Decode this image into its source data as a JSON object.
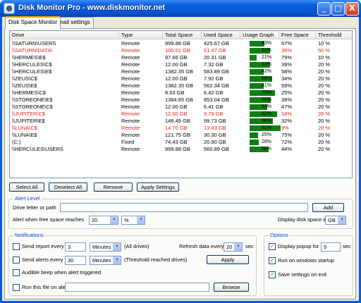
{
  "window": {
    "title": "Disk Monitor Pro - www.diskmonitor.net",
    "minimize_glyph": "_",
    "maximize_glyph": "□",
    "close_glyph": "X"
  },
  "tabs": [
    {
      "label": "Disk Space Monitor",
      "active": true
    },
    {
      "label": "Email settings",
      "active": false
    }
  ],
  "table": {
    "columns": [
      "Drive",
      "Type",
      "Total Space",
      "Used Space",
      "Usage Graph",
      "Free Space",
      "Threshold"
    ],
    "rows": [
      {
        "drive": "\\\\SATURN\\USERS",
        "type": "Remote",
        "total": "999.88 GB",
        "used": "425.67 GB",
        "usage": 43,
        "usage_label": "43%",
        "free": "57%",
        "threshold": "10 %",
        "alert": false
      },
      {
        "drive": "\\\\SATURN\\DATA\\",
        "type": "Remote",
        "total": "100.01 GB",
        "used": "61.47 GB",
        "usage": 61,
        "usage_label": "61%",
        "free": "39%",
        "threshold": "50 %",
        "alert": true
      },
      {
        "drive": "\\\\HERMES\\E$",
        "type": "Remote",
        "total": "97.66 GB",
        "used": "20.31 GB",
        "usage": 21,
        "usage_label": "21%",
        "free": "79%",
        "threshold": "10 %",
        "alert": false
      },
      {
        "drive": "\\\\HERCULES\\C$",
        "type": "Remote",
        "total": "12.00 GB",
        "used": "7.32 GB",
        "usage": 61,
        "usage_label": "61%",
        "free": "39%",
        "threshold": "20 %",
        "alert": false
      },
      {
        "drive": "\\\\HERCULES\\E$",
        "type": "Remote",
        "total": "1382.35 GB",
        "used": "583.89 GB",
        "usage": 42,
        "usage_label": "42%",
        "free": "58%",
        "threshold": "20 %",
        "alert": false
      },
      {
        "drive": "\\\\ZEUS\\C$",
        "type": "Remote",
        "total": "12.00 GB",
        "used": "7.92 GB",
        "usage": 66,
        "usage_label": "66%",
        "free": "34%",
        "threshold": "20 %",
        "alert": false
      },
      {
        "drive": "\\\\ZEUS\\E$",
        "type": "Remote",
        "total": "1382.35 GB",
        "used": "562.34 GB",
        "usage": 41,
        "usage_label": "41%",
        "free": "59%",
        "threshold": "20 %",
        "alert": false
      },
      {
        "drive": "\\\\HERMES\\C$",
        "type": "Remote",
        "total": "8.53 GB",
        "used": "6.42 GB",
        "usage": 75,
        "usage_label": "75%",
        "free": "25%",
        "threshold": "20 %",
        "alert": false
      },
      {
        "drive": "\\\\STOREONE\\E$",
        "type": "Remote",
        "total": "1384.85 GB",
        "used": "853.04 GB",
        "usage": 62,
        "usage_label": "62%",
        "free": "38%",
        "threshold": "20 %",
        "alert": false
      },
      {
        "drive": "\\\\STOREONE\\C$",
        "type": "Remote",
        "total": "12.00 GB",
        "used": "6.41 GB",
        "usage": 53,
        "usage_label": "53%",
        "free": "47%",
        "threshold": "20 %",
        "alert": false
      },
      {
        "drive": "\\\\JUPITER\\C$",
        "type": "Remote",
        "total": "12.00 GB",
        "used": "9.79 GB",
        "usage": 82,
        "usage_label": "82%",
        "free": "18%",
        "threshold": "20 %",
        "alert": true
      },
      {
        "drive": "\\\\JUPITER\\E$",
        "type": "Remote",
        "total": "146.49 GB",
        "used": "99.73 GB",
        "usage": 68,
        "usage_label": "68%",
        "free": "32%",
        "threshold": "20 %",
        "alert": false
      },
      {
        "drive": "\\\\LUNA\\C$",
        "type": "Remote",
        "total": "14.70 GB",
        "used": "13.43 GB",
        "usage": 91,
        "usage_label": "91%",
        "free": "9%",
        "threshold": "20 %",
        "alert": true
      },
      {
        "drive": "\\\\LUNA\\E$",
        "type": "Remote",
        "total": "121.75 GB",
        "used": "30.30 GB",
        "usage": 25,
        "usage_label": "25%",
        "free": "75%",
        "threshold": "20 %",
        "alert": false
      },
      {
        "drive": "(C:)",
        "type": "Fixed",
        "total": "74.43 GB",
        "used": "20.90 GB",
        "usage": 28,
        "usage_label": "28%",
        "free": "72%",
        "threshold": "20 %",
        "alert": false
      },
      {
        "drive": "\\\\HERCULES\\USERS",
        "type": "Remote",
        "total": "999.88 GB",
        "used": "560.89 GB",
        "usage": 56,
        "usage_label": "56%",
        "free": "44%",
        "threshold": "20 %",
        "alert": false
      }
    ]
  },
  "actions": {
    "select_all": "Select All",
    "deselect_all": "Deselect All",
    "remove": "Remove",
    "apply_settings": "Apply Settings"
  },
  "alert_level": {
    "title": "Alert Level",
    "drive_label": "Drive letter or path",
    "drive_value": "",
    "add_label": "Add",
    "free_space_label": "Alert when free space reaches",
    "free_space_value": "20",
    "unit_value": "%",
    "display_label": "Display disk space in",
    "display_value": "GB"
  },
  "notifications": {
    "title": "Notifications",
    "send_report_label": "Send report every",
    "send_report_value": "3",
    "send_report_unit": "Minutes",
    "send_report_note": "(All drives)",
    "refresh_label": "Refresh data every",
    "refresh_value": "20",
    "refresh_unit": "sec",
    "send_alerts_label": "Send alerts every",
    "send_alerts_value": "30",
    "send_alerts_unit": "Minutes",
    "send_alerts_note": "(Threshold reached drives)",
    "apply_label": "Apply",
    "audible_label": "Audible beep when alert triggered",
    "run_file_label": "Run this file on alert",
    "run_file_value": "",
    "browse_label": "Browse"
  },
  "options": {
    "title": "Options",
    "popup_label": "Display popup for",
    "popup_value": "5",
    "popup_unit": "sec",
    "startup_label": "Run on windows startup",
    "save_label": "Save settings on exit"
  },
  "colors": {
    "usage_bar": "#0f7f12",
    "alert_text": "#e0231e",
    "group_title": "#0046d5"
  }
}
